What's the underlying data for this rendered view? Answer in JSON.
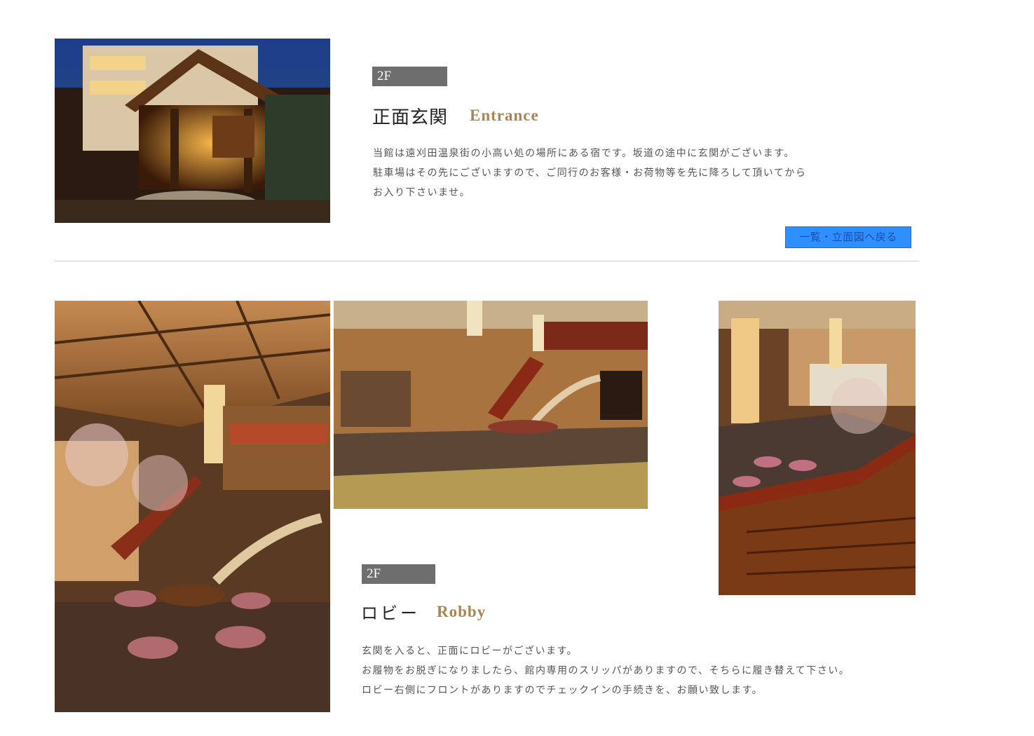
{
  "entrance": {
    "floor": "2F",
    "title_ja": "正面玄関",
    "title_en": "Entrance",
    "desc_lines": [
      "当館は遠刈田温泉街の小高い処の場所にある宿です。坂道の途中に玄関がございます。",
      "駐車場はその先にございますので、ご同行のお客様・お荷物等を先に降ろして頂いてから",
      "お入り下さいませ。"
    ],
    "back_button": "一覧・立面図へ戻る",
    "photo": "hotel-entrance-night-photo"
  },
  "lobby": {
    "floor": "2F",
    "title_ja": "ロビー",
    "title_en": "Robby",
    "desc_lines": [
      "玄関を入ると、正面にロビーがございます。",
      "お履物をお脱ぎになりましたら、館内専用のスリッパがありますので、そちらに履き替えて下さい。",
      "ロビー右側にフロントがありますのでチェックインの手続きを、お願い致します。"
    ],
    "photos": [
      "lobby-seating-photo",
      "lobby-hall-photo",
      "lobby-staircase-photo"
    ]
  },
  "colors": {
    "badge": "#6e6e6e",
    "title_en": "#a58654",
    "button": "#2f8fff",
    "divider": "#cfcfcf"
  }
}
